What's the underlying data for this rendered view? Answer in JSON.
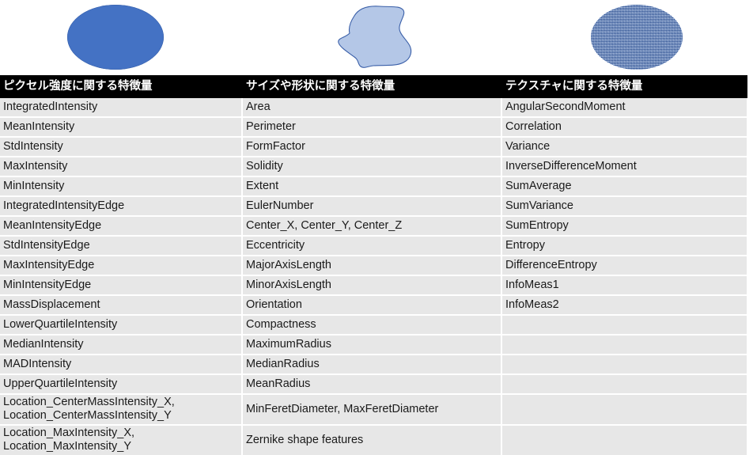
{
  "shapes": [
    {
      "name": "solid-blue-ellipse",
      "fill": "#4472C4",
      "style": "solid"
    },
    {
      "name": "irregular-blob",
      "fill": "#B4C7E7",
      "stroke": "#3A5FA8",
      "style": "outline"
    },
    {
      "name": "textured-blue-ellipse",
      "fill": "#5680C6",
      "style": "texture"
    }
  ],
  "colors": {
    "header_bg": "#000000",
    "header_text": "#FFFFFF",
    "row_bg": "#E7E7E7",
    "row_separator": "#FFFFFF",
    "accent_blue": "#4472C4",
    "light_blue": "#B4C7E7"
  },
  "table": {
    "headers": [
      "ピクセル強度に関する特徴量",
      "サイズや形状に関する特徴量",
      "テクスチャに関する特徴量"
    ],
    "columns": [
      [
        "IntegratedIntensity",
        "MeanIntensity",
        "StdIntensity",
        "MaxIntensity",
        "MinIntensity",
        "IntegratedIntensityEdge",
        "MeanIntensityEdge",
        "StdIntensityEdge",
        "MaxIntensityEdge",
        "MinIntensityEdge",
        "MassDisplacement",
        "LowerQuartileIntensity",
        "MedianIntensity",
        "MADIntensity",
        "UpperQuartileIntensity",
        "Location_CenterMassIntensity_X,\nLocation_CenterMassIntensity_Y",
        "Location_MaxIntensity_X,\nLocation_MaxIntensity_Y"
      ],
      [
        "Area",
        "Perimeter",
        "FormFactor",
        "Solidity",
        "Extent",
        "EulerNumber",
        "Center_X, Center_Y, Center_Z",
        "Eccentricity",
        "MajorAxisLength",
        "MinorAxisLength",
        "Orientation",
        "Compactness",
        "MaximumRadius",
        "MedianRadius",
        "MeanRadius",
        "MinFeretDiameter, MaxFeretDiameter",
        "Zernike shape features"
      ],
      [
        "AngularSecondMoment",
        "Correlation",
        "Variance",
        "InverseDifferenceMoment",
        "SumAverage",
        "SumVariance",
        "SumEntropy",
        "Entropy",
        "DifferenceEntropy",
        "InfoMeas1",
        "InfoMeas2",
        "",
        "",
        "",
        "",
        "",
        ""
      ]
    ]
  }
}
